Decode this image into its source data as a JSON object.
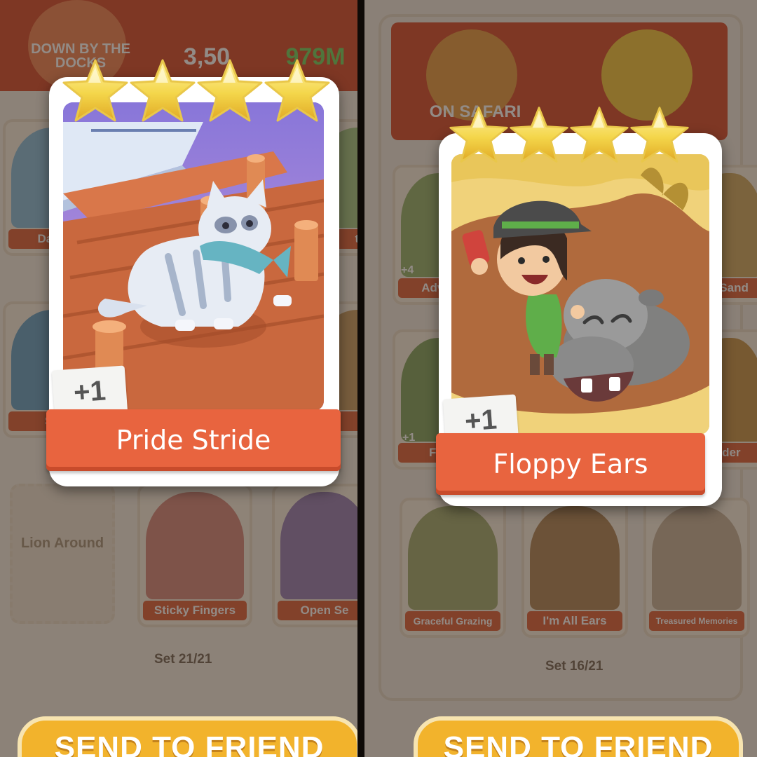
{
  "left": {
    "header": {
      "album_title": "DOWN BY THE DOCKS",
      "dice": "3,50",
      "money": "979M"
    },
    "card": {
      "name": "Pride Stride",
      "count_badge": "+1",
      "stars": 4
    },
    "background_cards": {
      "left_col_1": "Day at",
      "right_col_1": "tri",
      "left_col_2": "Sea",
      "right_col_2": "e",
      "locked_name": "Lion Around",
      "bottom_2": "Sticky Fingers",
      "bottom_3": "Open Se"
    },
    "set_count": "Set 21/21",
    "send_label": "SEND TO FRIEND"
  },
  "right": {
    "header": {
      "album_title": "ON SAFARI"
    },
    "card": {
      "name": "Floppy Ears",
      "count_badge": "+1",
      "stars": 4
    },
    "background_cards": {
      "left_col_1_badge": "+4",
      "left_col_1": "Advent",
      "right_col_1": "e Sand",
      "left_col_2_badge": "+1",
      "left_col_2": "Flop",
      "right_col_2": "rder",
      "bottom_1": "Graceful Grazing",
      "bottom_2": "I'm All Ears",
      "bottom_3": "Treasured Memories"
    },
    "set_count": "Set 16/21",
    "send_label": "SEND TO FRIEND"
  },
  "colors": {
    "ribbon": "#e8643f",
    "star": "#f4d64a",
    "button": "#f2b32c"
  }
}
